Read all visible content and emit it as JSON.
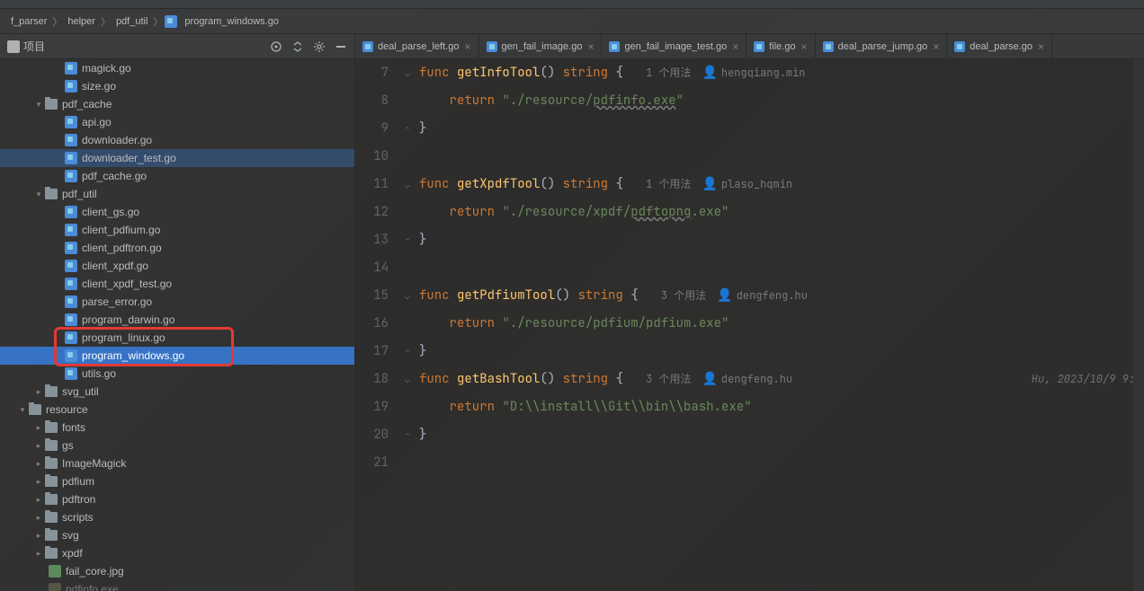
{
  "breadcrumb": {
    "root": "f_parser",
    "p1": "helper",
    "p2": "pdf_util",
    "file": "program_windows.go"
  },
  "sidebar": {
    "title": "项目",
    "tree": {
      "magick": "magick.go",
      "size": "size.go",
      "pdf_cache": "pdf_cache",
      "api": "api.go",
      "downloader": "downloader.go",
      "downloader_test": "downloader_test.go",
      "pdf_cache_go": "pdf_cache.go",
      "pdf_util": "pdf_util",
      "client_gs": "client_gs.go",
      "client_pdfium": "client_pdfium.go",
      "client_pdftron": "client_pdftron.go",
      "client_xpdf": "client_xpdf.go",
      "client_xpdf_test": "client_xpdf_test.go",
      "parse_error": "parse_error.go",
      "program_darwin": "program_darwin.go",
      "program_linux": "program_linux.go",
      "program_windows": "program_windows.go",
      "utils": "utils.go",
      "svg_util": "svg_util",
      "resource": "resource",
      "fonts": "fonts",
      "gs": "gs",
      "ImageMagick": "ImageMagick",
      "pdfium": "pdfium",
      "pdftron": "pdftron",
      "scripts": "scripts",
      "svg": "svg",
      "xpdf": "xpdf",
      "fail_core": "fail_core.jpg",
      "pdfinfo_exe": "pdfinfo.exe"
    }
  },
  "tabs": {
    "t1": "deal_parse_left.go",
    "t2": "gen_fail_image.go",
    "t3": "gen_fail_image_test.go",
    "t4": "file.go",
    "t5": "deal_parse_jump.go",
    "t6": "deal_parse.go"
  },
  "code": {
    "kw_func": "func",
    "kw_return": "return",
    "kw_string": "string",
    "usage1": "1 个用法",
    "usage3": "3 个用法",
    "fn1": "getInfoTool",
    "au1": "hengqiang.min",
    "str1a": "\"./resource/",
    "str1b": "pdfinfo.exe",
    "str1c": "\"",
    "fn2": "getXpdfTool",
    "au2": "plaso_hqmin",
    "str2a": "\"./resource/xpdf/",
    "str2b": "pdftopng",
    "str2c": ".exe\"",
    "fn3": "getPdfiumTool",
    "au3": "dengfeng.hu",
    "str3": "\"./resource/pdfium/pdfium.exe\"",
    "fn4": "getBashTool",
    "au4": "dengfeng.hu",
    "str4": "\"D:\\\\install\\\\Git\\\\bin\\\\bash.exe\"",
    "blame": "Hu, 2023/10/9 9:",
    "ln7": "7",
    "ln8": "8",
    "ln9": "9",
    "ln10": "10",
    "ln11": "11",
    "ln12": "12",
    "ln13": "13",
    "ln14": "14",
    "ln15": "15",
    "ln16": "16",
    "ln17": "17",
    "ln18": "18",
    "ln19": "19",
    "ln20": "20",
    "ln21": "21"
  }
}
